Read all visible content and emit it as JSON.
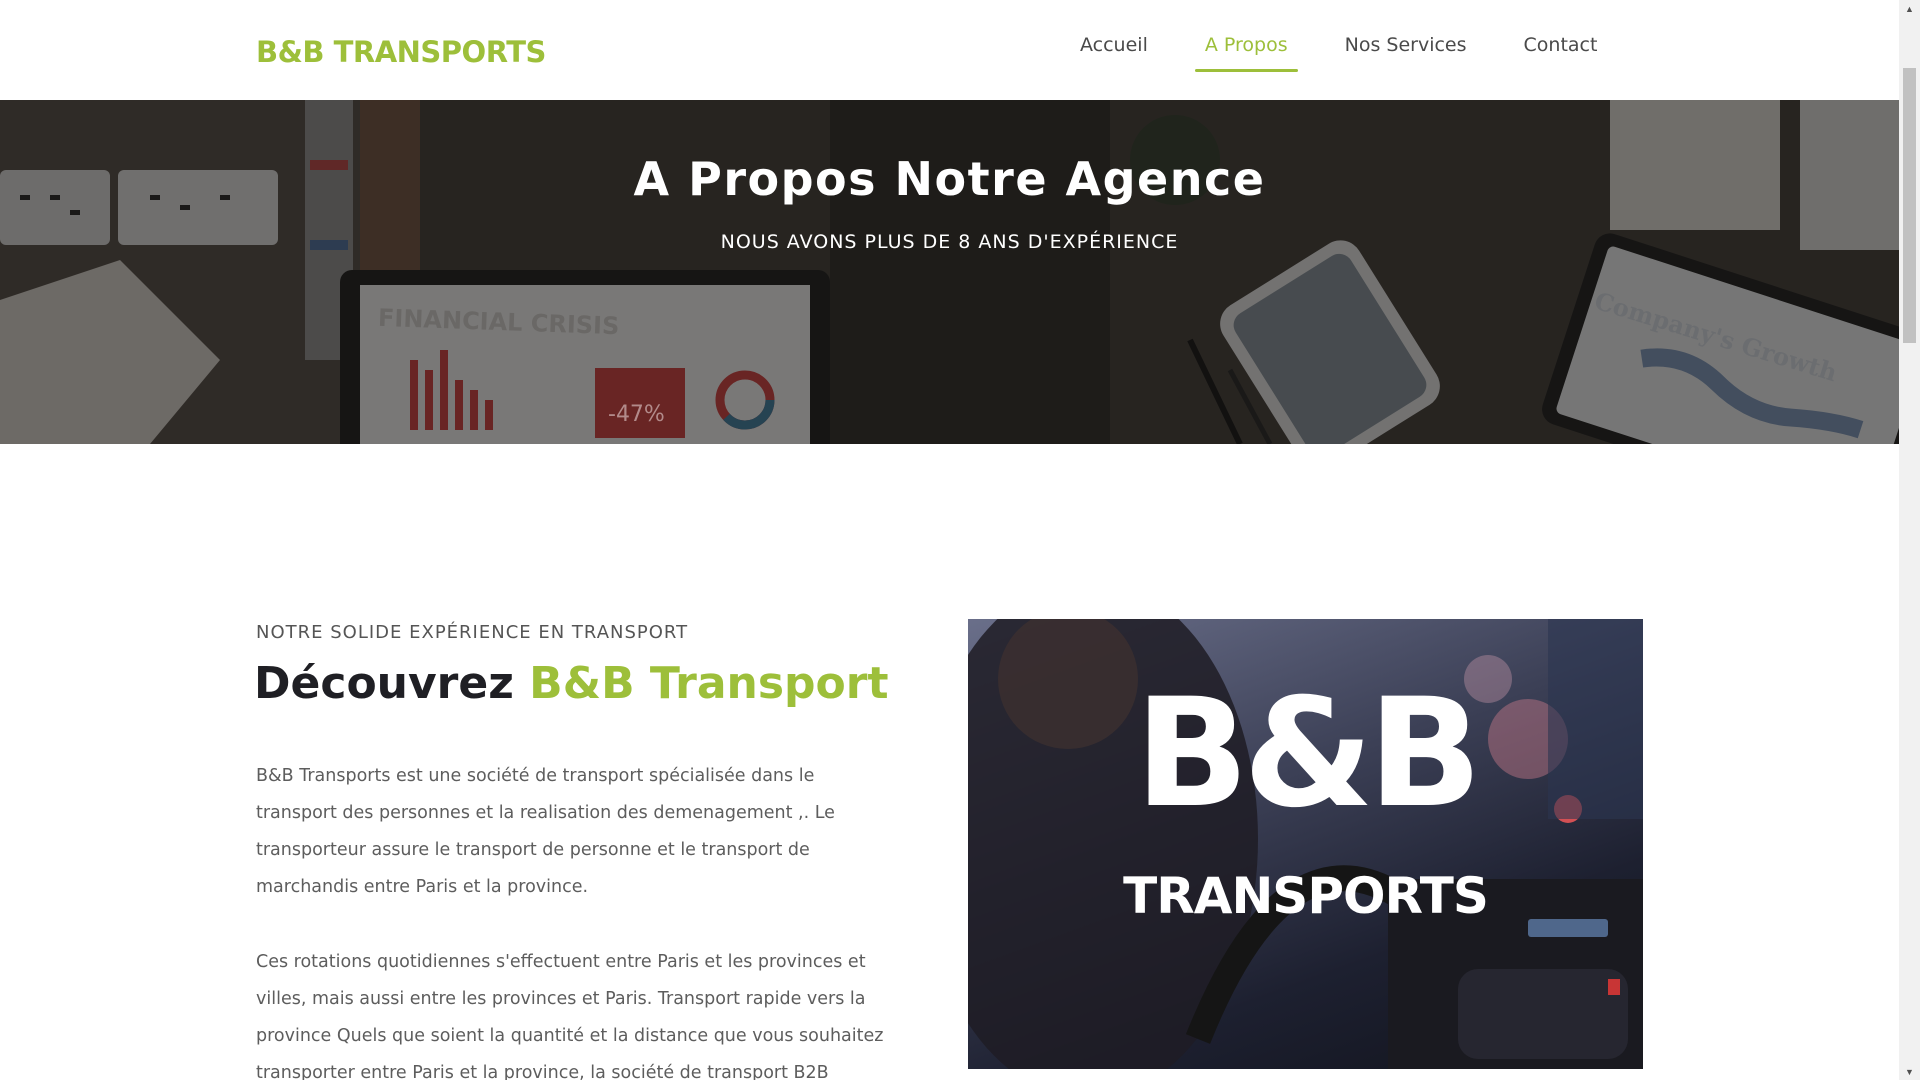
{
  "header": {
    "logo": "B&B TRANSPORTS",
    "nav": [
      {
        "label": "Accueil",
        "active": false
      },
      {
        "label": "A Propos",
        "active": true
      },
      {
        "label": "Nos Services",
        "active": false
      },
      {
        "label": "Contact",
        "active": false
      }
    ]
  },
  "hero": {
    "title": "A Propos Notre Agence",
    "subtitle": "NOUS AVONS PLUS DE 8 ANS D'EXPÉRIENCE",
    "image_texts": {
      "laptop_heading": "FINANCIAL CRISIS",
      "laptop_value": "-47%",
      "tablet_heading": "Company's Growth"
    }
  },
  "about": {
    "eyebrow": "NOTRE SOLIDE EXPÉRIENCE EN TRANSPORT",
    "title_plain": "Découvrez",
    "title_accent": "B&B Transport",
    "paragraph_1": "B&B Transports est une société de transport spécialisée dans le transport des personnes et la realisation des demenagement ,. Le transporteur assure le transport de personne et le transport de marchandis entre Paris et la province.",
    "paragraph_2": "Ces rotations quotidiennes s'effectuent entre Paris et les provinces et villes, mais aussi entre les provinces et Paris. Transport rapide vers la province Quels que soient la quantité et la distance que vous souhaitez transporter entre Paris et la province, la société de transport B2B",
    "image_brand_big": "B&B",
    "image_brand_small": "TRANSPORTS"
  },
  "colors": {
    "accent": "#9dbf3a",
    "heading": "#1f1f24",
    "body_text": "#5d5d5d"
  },
  "icons": {
    "scroll_up": "triangle-up-icon",
    "scroll_down": "triangle-down-icon"
  }
}
